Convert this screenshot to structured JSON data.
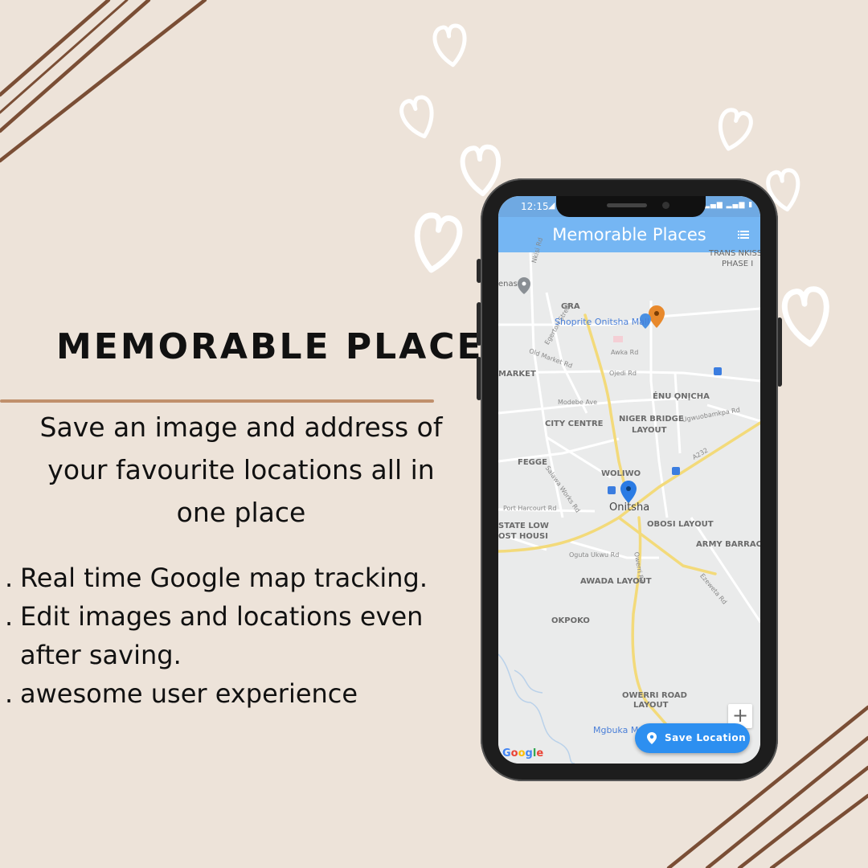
{
  "promo": {
    "title": "MEMORABLE PLACES",
    "tagline_lines": [
      "Save an image and address of",
      "your favourite locations all in",
      "one place"
    ],
    "features": [
      {
        "bullet": ".",
        "text": "Real time Google map tracking."
      },
      {
        "bullet": ".",
        "text": "Edit images and locations even"
      },
      {
        "bullet": "",
        "text": "after saving."
      },
      {
        "bullet": ".",
        "text": "awesome user experience"
      }
    ]
  },
  "colors": {
    "background": "#ede3d9",
    "stripes": "#7a4e35",
    "title_rule": "#c0906c",
    "appbar": "#75b6f3",
    "fab": "#2d8ff0",
    "pin_blue": "#2a7be4",
    "pin_orange": "#e8892c"
  },
  "phone": {
    "status_time": "12:15",
    "appbar_title": "Memorable Places",
    "menu_icon": "list-icon",
    "fab_label": "Save Location",
    "fab_icon": "location-pin-icon",
    "zoom_label": "+",
    "google_logo": "Google"
  },
  "map_labels": {
    "nkisi_rd": "Nkisi Rd",
    "trans_nkiss": "TRANS NKISS",
    "phase": "PHASE I",
    "enas": "enas",
    "gra": "GRA",
    "egerton": "Egerton Street",
    "shoprite": "Shoprite Onitsha Mall",
    "old_market": "Old Market Rd",
    "awka": "Awka Rd",
    "market": "MARKET",
    "ojedi": "Ojedi Rd",
    "enu_onicha": "ÉNU ỌNỊCHA",
    "modebe": "Modebe Ave",
    "city_centre": "CITY CENTRE",
    "niger_bridge_1": "NIGER BRIDGE",
    "niger_bridge_2": "LAYOUT",
    "ugwu": "Ugwuobamkpa Rd",
    "fegge": "FEGGE",
    "salawa": "Salawa Works Rd",
    "woliwo": "WOLIWO",
    "onitsha": "Onitsha",
    "port_harcourt": "Port Harcourt Rd",
    "state_low_1": "STATE LOW",
    "state_low_2": "OST HOUSI",
    "obosi": "OBOSI LAYOUT",
    "army": "ARMY BARRACKS",
    "oguta": "Oguta Ukwu Rd",
    "owerri_rd": "Owerri Rd",
    "awada": "AWADA LAYOUT",
    "ezeweta": "Ezeweta Rd",
    "okpoko": "OKPOKO",
    "owerri_road_1": "OWERRI ROAD",
    "owerri_road_2": "LAYOUT",
    "mgbuka": "Mgbuka Ma",
    "a232": "A232"
  }
}
